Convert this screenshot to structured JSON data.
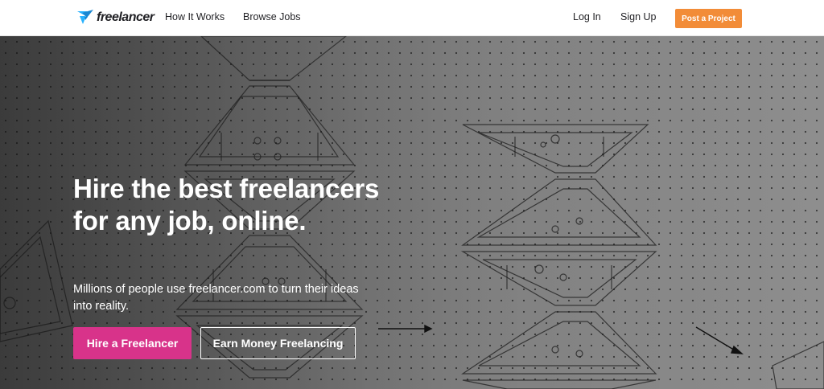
{
  "header": {
    "logo_text": "freelancer",
    "nav": {
      "how_it_works": "How It Works",
      "browse_jobs": "Browse Jobs",
      "log_in": "Log In",
      "sign_up": "Sign Up"
    },
    "post_project_label": "Post a Project"
  },
  "hero": {
    "title": "Hire the best freelancers for any job, online.",
    "subtitle": "Millions of people use freelancer.com to turn their ideas into reality.",
    "hire_button_label": "Hire a Freelancer",
    "earn_button_label": "Earn Money Freelancing"
  },
  "colors": {
    "brand_blue": "#29b2fe",
    "post_button": "#f28c38",
    "hire_button": "#d8338a",
    "text_dark": "#1f1f23"
  },
  "icons": {
    "logo": "freelancer-bird-icon",
    "arrow": "arrow-right-icon"
  }
}
